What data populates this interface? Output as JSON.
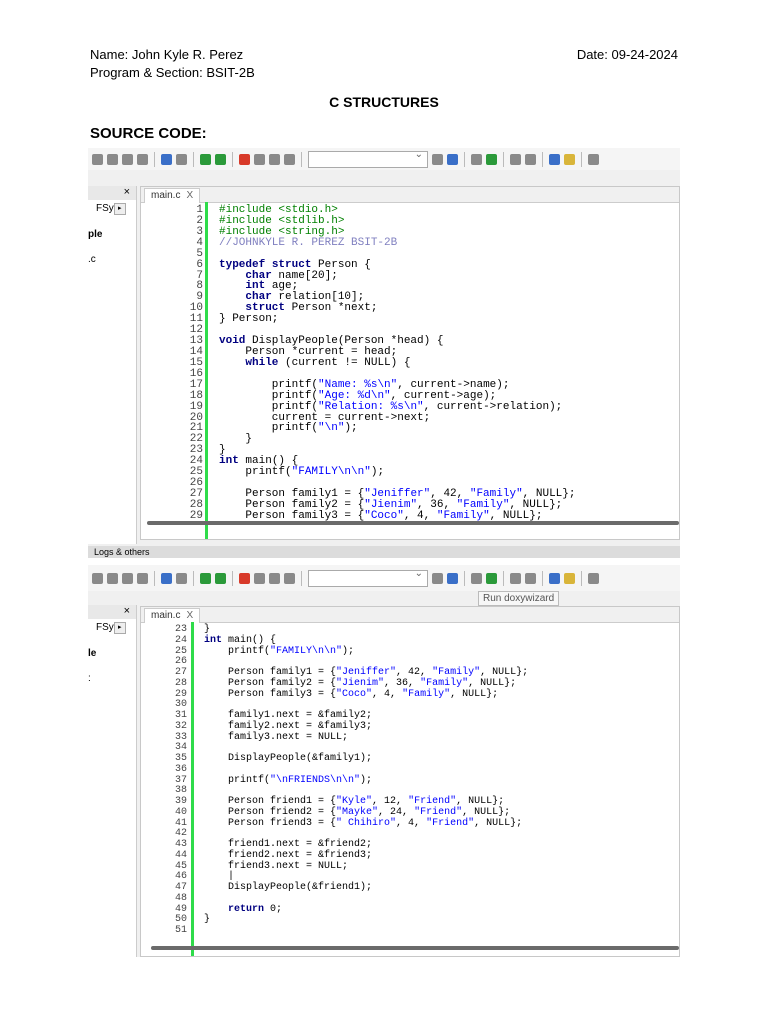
{
  "header": {
    "name": "Name: John Kyle R. Perez",
    "program": "Program & Section: BSIT-2B",
    "date": "Date: 09-24-2024",
    "title": "C STRUCTURES",
    "section_label": "SOURCE CODE:"
  },
  "colors": {
    "gutter_changed": "#2fdc4a",
    "keyword": "#000080",
    "string": "#0000ff",
    "number": "#ff00ff",
    "operator": "#ff0000",
    "preprocessor": "#008000",
    "comment": "#a0a0d8"
  },
  "screenshots": [
    {
      "tab_label": "main.c",
      "tab_close": "X",
      "panel_close": "×",
      "panel_tab": "FSy",
      "panel_item": "ple",
      "panel_item2": ".c",
      "logs_label": "Logs & others",
      "first_line": 1,
      "lines": [
        "#include <stdio.h>",
        "#include <stdlib.h>",
        "#include <string.h>",
        "//JOHNKYLE R. PEREZ BSIT-2B",
        "",
        "typedef struct Person {",
        "    char name[20];",
        "    int age;",
        "    char relation[10];",
        "    struct Person *next;",
        "} Person;",
        "",
        "void DisplayPeople(Person *head) {",
        "    Person *current = head;",
        "    while (current != NULL) {",
        "",
        "        printf(\"Name: %s\\n\", current->name);",
        "        printf(\"Age: %d\\n\", current->age);",
        "        printf(\"Relation: %s\\n\", current->relation);",
        "        current = current->next;",
        "        printf(\"\\n\");",
        "    }",
        "}",
        "int main() {",
        "    printf(\"FAMILY\\n\\n\");",
        "",
        "    Person family1 = {\"Jeniffer\", 42, \"Family\", NULL};",
        "    Person family2 = {\"Jienim\", 36, \"Family\", NULL};",
        "    Person family3 = {\"Coco\", 4, \"Family\", NULL};"
      ]
    },
    {
      "tab_label": "main.c",
      "tab_close": "X",
      "panel_close": "×",
      "panel_tab": "FSy",
      "panel_item": "le",
      "panel_item2": ":",
      "tooltip": "Run doxywizard",
      "first_line": 23,
      "lines": [
        "}",
        "int main() {",
        "    printf(\"FAMILY\\n\\n\");",
        "",
        "    Person family1 = {\"Jeniffer\", 42, \"Family\", NULL};",
        "    Person family2 = {\"Jienim\", 36, \"Family\", NULL};",
        "    Person family3 = {\"Coco\", 4, \"Family\", NULL};",
        "",
        "    family1.next = &family2;",
        "    family2.next = &family3;",
        "    family3.next = NULL;",
        "",
        "    DisplayPeople(&family1);",
        "",
        "    printf(\"\\nFRIENDS\\n\\n\");",
        "",
        "    Person friend1 = {\"Kyle\", 12, \"Friend\", NULL};",
        "    Person friend2 = {\"Mayke\", 24, \"Friend\", NULL};",
        "    Person friend3 = {\" Chihiro\", 4, \"Friend\", NULL};",
        "",
        "    friend1.next = &friend2;",
        "    friend2.next = &friend3;",
        "    friend3.next = NULL;",
        "    |",
        "    DisplayPeople(&friend1);",
        "",
        "    return 0;",
        "}",
        ""
      ]
    }
  ]
}
